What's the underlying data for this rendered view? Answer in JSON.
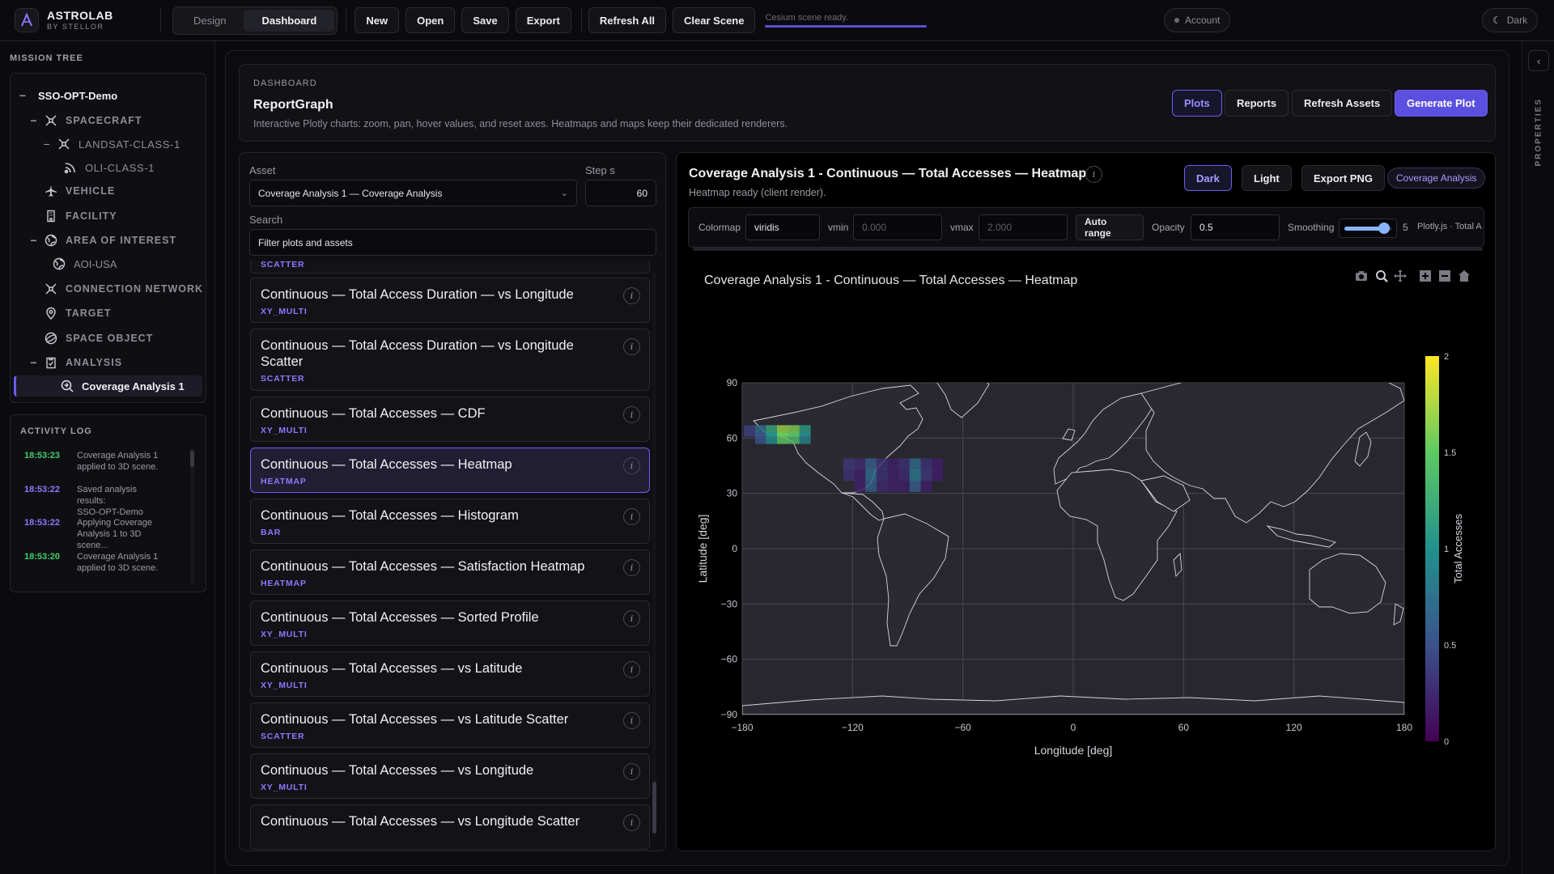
{
  "brand": {
    "name": "ASTROLAB",
    "sub": "BY STELLOR"
  },
  "modes": [
    "Design",
    "Dashboard"
  ],
  "toolbar": {
    "new": "New",
    "open": "Open",
    "save": "Save",
    "export": "Export",
    "refresh_all": "Refresh All",
    "clear_scene": "Clear Scene"
  },
  "status_text": "Cesium scene ready.",
  "account": "Account",
  "theme": "Dark",
  "mission_tree": {
    "title": "MISSION TREE",
    "root": "SSO-OPT-Demo",
    "spacecraft": "SPACECRAFT",
    "landsat": "LANDSAT-CLASS-1",
    "oli": "OLI-CLASS-1",
    "vehicle": "VEHICLE",
    "facility": "FACILITY",
    "aoi": "AREA OF INTEREST",
    "aoi_usa": "AOI-USA",
    "connection": "CONNECTION NETWORK",
    "target": "TARGET",
    "space_object": "SPACE OBJECT",
    "analysis": "ANALYSIS",
    "coverage": "Coverage Analysis 1"
  },
  "activity": {
    "title": "ACTIVITY LOG",
    "entries": [
      {
        "time": "18:53:23",
        "line1": "Coverage Analysis 1",
        "line2": "applied to 3D scene.",
        "color": "#3ecf6e"
      },
      {
        "time": "18:53:22",
        "line1": "Saved analysis results:",
        "line2": "SSO-OPT-Demo",
        "color": "#8d79ff"
      },
      {
        "time": "18:53:22",
        "line1": "Applying Coverage",
        "line2": "Analysis 1 to 3D scene...",
        "color": "#8d79ff"
      },
      {
        "time": "18:53:20",
        "line1": "Coverage Analysis 1",
        "line2": "applied to 3D scene.",
        "color": "#3ecf6e"
      }
    ]
  },
  "header": {
    "kicker": "DASHBOARD",
    "title": "ReportGraph",
    "desc": "Interactive Plotly charts: zoom, pan, hover values, and reset axes. Heatmaps and maps keep their dedicated renderers.",
    "plots": "Plots",
    "reports": "Reports",
    "refresh_assets": "Refresh Assets",
    "generate": "Generate Plot"
  },
  "list": {
    "asset_label": "Asset",
    "asset_value": "Coverage Analysis 1 — Coverage Analysis",
    "step_label": "Step s",
    "step_value": "60",
    "search_label": "Search",
    "search_placeholder": "Filter plots and assets",
    "top_tag": "SCATTER",
    "items": [
      {
        "title": "Continuous — Total Access Duration — vs Longitude",
        "tag": "XY_MULTI"
      },
      {
        "title": "Continuous — Total Access Duration — vs Longitude Scatter",
        "tag": "SCATTER"
      },
      {
        "title": "Continuous — Total Accesses — CDF",
        "tag": "XY_MULTI"
      },
      {
        "title": "Continuous — Total Accesses — Heatmap",
        "tag": "HEATMAP"
      },
      {
        "title": "Continuous — Total Accesses — Histogram",
        "tag": "BAR"
      },
      {
        "title": "Continuous — Total Accesses — Satisfaction Heatmap",
        "tag": "HEATMAP"
      },
      {
        "title": "Continuous — Total Accesses — Sorted Profile",
        "tag": "XY_MULTI"
      },
      {
        "title": "Continuous — Total Accesses — vs Latitude",
        "tag": "XY_MULTI"
      },
      {
        "title": "Continuous — Total Accesses — vs Latitude Scatter",
        "tag": "SCATTER"
      },
      {
        "title": "Continuous — Total Accesses — vs Longitude",
        "tag": "XY_MULTI"
      },
      {
        "title": "Continuous — Total Accesses — vs Longitude Scatter",
        "tag": ""
      }
    ]
  },
  "plot": {
    "title": "Coverage Analysis 1 - Continuous — Total Accesses — Heatmap",
    "subtitle": "Heatmap ready (client render).",
    "dark": "Dark",
    "light": "Light",
    "export_png": "Export PNG",
    "badge": "Coverage Analysis",
    "colormap_label": "Colormap",
    "colormap": "viridis",
    "vmin_label": "vmin",
    "vmin_ph": "0.000",
    "vmax_label": "vmax",
    "vmax_ph": "2.000",
    "auto_range": "Auto range",
    "opacity_label": "Opacity",
    "opacity": "0.5",
    "smoothing_label": "Smoothing",
    "smoothing": "5",
    "renderer": "Plotly.js · Total A"
  },
  "chart_data": {
    "type": "heatmap",
    "title": "Coverage Analysis 1 - Continuous — Total Accesses — Heatmap",
    "xlabel": "Longitude [deg]",
    "ylabel": "Latitude [deg]",
    "colorbar_title": "Total Accesses",
    "colorscale": "viridis",
    "xlim": [
      -180,
      180
    ],
    "ylim": [
      -90,
      90
    ],
    "zlim": [
      0,
      2
    ],
    "xticks": [
      "−180",
      "−120",
      "−60",
      "0",
      "60",
      "120",
      "180"
    ],
    "yticks": [
      "90",
      "60",
      "30",
      "0",
      "−30",
      "−60",
      "−90"
    ],
    "cticks": [
      "2",
      "1.5",
      "1",
      "0.5",
      "0"
    ],
    "cells": [
      {
        "lon": -176,
        "lat": 64,
        "z": 0.4
      },
      {
        "lon": -170,
        "lat": 64,
        "z": 0.7
      },
      {
        "lon": -164,
        "lat": 64,
        "z": 1.2
      },
      {
        "lon": -158,
        "lat": 64,
        "z": 1.7
      },
      {
        "lon": -152,
        "lat": 64,
        "z": 1.6
      },
      {
        "lon": -146,
        "lat": 64,
        "z": 1.1
      },
      {
        "lon": -170,
        "lat": 60,
        "z": 0.5
      },
      {
        "lon": -164,
        "lat": 60,
        "z": 1.0
      },
      {
        "lon": -158,
        "lat": 60,
        "z": 1.5
      },
      {
        "lon": -152,
        "lat": 60,
        "z": 1.4
      },
      {
        "lon": -146,
        "lat": 60,
        "z": 0.9
      },
      {
        "lon": -122,
        "lat": 46,
        "z": 0.35
      },
      {
        "lon": -116,
        "lat": 46,
        "z": 0.25
      },
      {
        "lon": -110,
        "lat": 46,
        "z": 0.6
      },
      {
        "lon": -104,
        "lat": 46,
        "z": 0.3
      },
      {
        "lon": -98,
        "lat": 46,
        "z": 0.2
      },
      {
        "lon": -92,
        "lat": 46,
        "z": 0.3
      },
      {
        "lon": -86,
        "lat": 46,
        "z": 0.7
      },
      {
        "lon": -80,
        "lat": 46,
        "z": 0.3
      },
      {
        "lon": -74,
        "lat": 46,
        "z": 0.2
      },
      {
        "lon": -122,
        "lat": 40,
        "z": 0.3
      },
      {
        "lon": -116,
        "lat": 40,
        "z": 0.2
      },
      {
        "lon": -110,
        "lat": 40,
        "z": 0.7
      },
      {
        "lon": -104,
        "lat": 40,
        "z": 0.3
      },
      {
        "lon": -98,
        "lat": 40,
        "z": 0.2
      },
      {
        "lon": -92,
        "lat": 40,
        "z": 0.25
      },
      {
        "lon": -86,
        "lat": 40,
        "z": 0.8
      },
      {
        "lon": -80,
        "lat": 40,
        "z": 0.35
      },
      {
        "lon": -74,
        "lat": 40,
        "z": 0.2
      },
      {
        "lon": -116,
        "lat": 34,
        "z": 0.2
      },
      {
        "lon": -110,
        "lat": 34,
        "z": 0.6
      },
      {
        "lon": -104,
        "lat": 34,
        "z": 0.25
      },
      {
        "lon": -98,
        "lat": 34,
        "z": 0.2
      },
      {
        "lon": -92,
        "lat": 34,
        "z": 0.2
      },
      {
        "lon": -86,
        "lat": 34,
        "z": 0.6
      },
      {
        "lon": -80,
        "lat": 34,
        "z": 0.2
      }
    ]
  },
  "colors": {
    "accent": "#6a5df0",
    "tag": "#8d79ff",
    "success": "#3ecf6e",
    "bg": "#0a0a0c"
  }
}
